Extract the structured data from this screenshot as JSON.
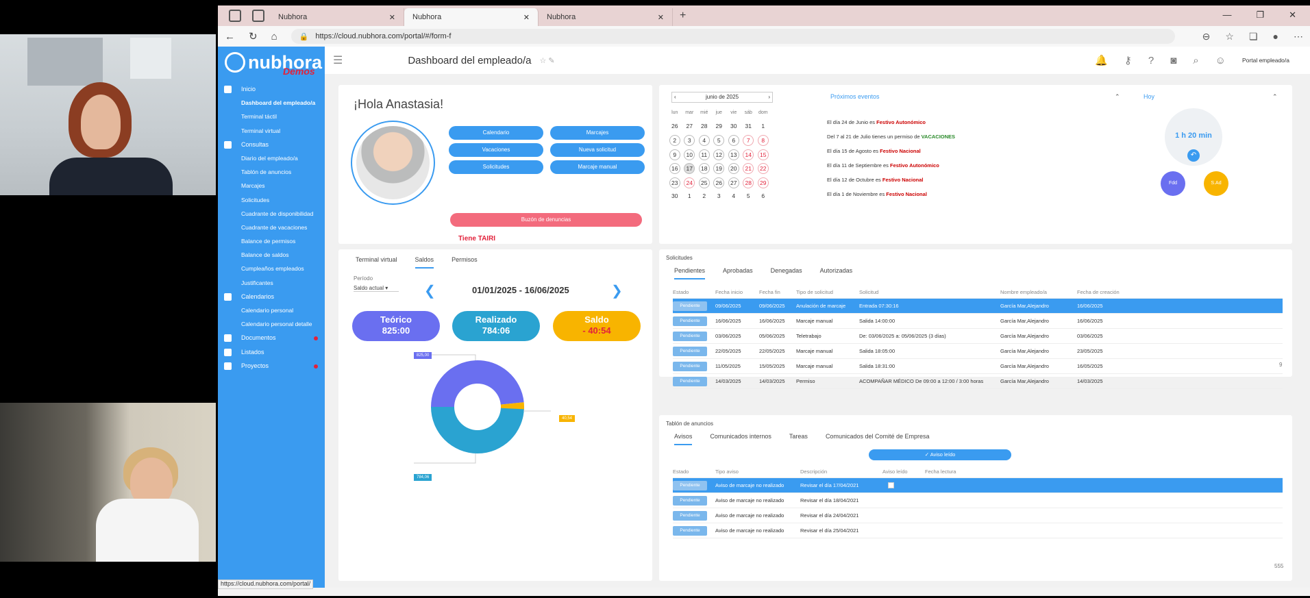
{
  "browser": {
    "tabs": [
      "Nubhora",
      "Nubhora",
      "Nubhora"
    ],
    "url": "https://cloud.nubhora.com/portal/#/form-f",
    "status_url": "https://cloud.nubhora.com/portal/"
  },
  "sidebar": {
    "logo": "nubhora",
    "demos": "Demos",
    "items": [
      {
        "label": "Inicio",
        "type": "sec"
      },
      {
        "label": "Dashboard del empleado/a",
        "type": "sub",
        "bold": true
      },
      {
        "label": "Terminal táctil",
        "type": "sub"
      },
      {
        "label": "Terminal virtual",
        "type": "sub"
      },
      {
        "label": "Consultas",
        "type": "sec"
      },
      {
        "label": "Diario del empleado/a",
        "type": "sub"
      },
      {
        "label": "Tablón de anuncios",
        "type": "sub"
      },
      {
        "label": "Marcajes",
        "type": "sub"
      },
      {
        "label": "Solicitudes",
        "type": "sub"
      },
      {
        "label": "Cuadrante de disponibilidad",
        "type": "sub"
      },
      {
        "label": "Cuadrante de vacaciones",
        "type": "sub"
      },
      {
        "label": "Balance de permisos",
        "type": "sub"
      },
      {
        "label": "Balance de saldos",
        "type": "sub"
      },
      {
        "label": "Cumpleaños empleados",
        "type": "sub"
      },
      {
        "label": "Justificantes",
        "type": "sub"
      },
      {
        "label": "Calendarios",
        "type": "sec"
      },
      {
        "label": "Calendario personal",
        "type": "sub"
      },
      {
        "label": "Calendario personal detalle",
        "type": "sub"
      },
      {
        "label": "Documentos",
        "type": "sec",
        "dot": true
      },
      {
        "label": "Listados",
        "type": "sec"
      },
      {
        "label": "Proyectos",
        "type": "sec",
        "dot": true
      }
    ]
  },
  "header": {
    "title": "Dashboard del empleado/a",
    "portal": "Portal empleado/a"
  },
  "welcome": {
    "greeting": "¡Hola Anastasia!",
    "buttons": [
      "Calendario",
      "Marcajes",
      "Vacaciones",
      "Nueva solicitud",
      "Solicitudes",
      "Marcaje manual"
    ],
    "pink_button": "Buzón de denuncias",
    "tiene": "Tiene TAIRI"
  },
  "calendar": {
    "month": "junio de 2025",
    "days": [
      "lun",
      "mar",
      "mié",
      "jue",
      "vie",
      "sáb",
      "dom"
    ],
    "weeks": [
      [
        "26",
        "27",
        "28",
        "29",
        "30",
        "31",
        "1"
      ],
      [
        "2",
        "3",
        "4",
        "5",
        "6",
        "7",
        "8"
      ],
      [
        "9",
        "10",
        "11",
        "12",
        "13",
        "14",
        "15"
      ],
      [
        "16",
        "17",
        "18",
        "19",
        "20",
        "21",
        "22"
      ],
      [
        "23",
        "24",
        "25",
        "26",
        "27",
        "28",
        "29"
      ],
      [
        "30",
        "1",
        "2",
        "3",
        "4",
        "5",
        "6"
      ]
    ]
  },
  "events": {
    "title": "Próximos eventos",
    "items": [
      {
        "text": "El día 24 de Junio es ",
        "tag": "Festivo Autonómico",
        "green": false
      },
      {
        "text": "Del 7 al 21 de Julio tienes un permiso de ",
        "tag": "VACACIONES",
        "green": true
      },
      {
        "text": "El día 15 de Agosto es ",
        "tag": "Festivo Nacional",
        "green": false
      },
      {
        "text": "El día 11 de Septiembre es ",
        "tag": "Festivo Autonómico",
        "green": false
      },
      {
        "text": "El día 12 de Octubre es ",
        "tag": "Festivo Nacional",
        "green": false
      },
      {
        "text": "El día 1 de Noviembre es ",
        "tag": "Festivo Nacional",
        "green": false
      }
    ]
  },
  "today": {
    "title": "Hoy",
    "time": "1 h 20 min",
    "fdd": "Fdd",
    "sal": "S.Ad"
  },
  "balance": {
    "tabs": [
      "Terminal virtual",
      "Saldos",
      "Permisos"
    ],
    "periodo_label": "Período",
    "periodo_value": "Saldo actual",
    "range": "01/01/2025 - 16/06/2025",
    "teorico_label": "Teórico",
    "teorico_value": "825:00",
    "realizado_label": "Realizado",
    "realizado_value": "784:06",
    "saldo_label": "Saldo",
    "saldo_value": "- 40:54",
    "label_top": "825,00",
    "label_right": "40,54",
    "label_bottom": "784,06",
    "colors": {
      "teorico": "#6a6ff0",
      "realizado": "#2aa3d1",
      "saldo": "#f8b400"
    }
  },
  "chart_data": {
    "type": "pie",
    "categories": [
      "Teórico",
      "Realizado",
      "Saldo"
    ],
    "values": [
      825.0,
      784.06,
      40.54
    ]
  },
  "solicitudes": {
    "title": "Solicitudes",
    "tabs": [
      "Pendientes",
      "Aprobadas",
      "Denegadas",
      "Autorizadas"
    ],
    "columns": [
      "Estado",
      "Fecha inicio",
      "Fecha fin",
      "Tipo de solicitud",
      "Solicitud",
      "Nombre empleado/a",
      "Fecha de creación"
    ],
    "rows": [
      [
        "Pendiente",
        "09/06/2025",
        "09/06/2025",
        "Anulación de marcaje",
        "Entrada 07:30:16",
        "García Mar,Alejandro",
        "16/06/2025"
      ],
      [
        "Pendiente",
        "16/06/2025",
        "16/06/2025",
        "Marcaje manual",
        "Salida 14:00:00",
        "García Mar,Alejandro",
        "16/06/2025"
      ],
      [
        "Pendiente",
        "03/06/2025",
        "05/06/2025",
        "Teletrabajo",
        "De: 03/06/2025 a: 05/06/2025 (3 días)",
        "García Mar,Alejandro",
        "03/06/2025"
      ],
      [
        "Pendiente",
        "22/05/2025",
        "22/05/2025",
        "Marcaje manual",
        "Salida 18:05:00",
        "García Mar,Alejandro",
        "23/05/2025"
      ],
      [
        "Pendiente",
        "11/05/2025",
        "15/05/2025",
        "Marcaje manual",
        "Salida 18:31:00",
        "García Mar,Alejandro",
        "16/05/2025"
      ],
      [
        "Pendiente",
        "14/03/2025",
        "14/03/2025",
        "Permiso",
        "ACOMPAÑAR MÉDICO De 09:00 a 12:00 / 3:00 horas",
        "García Mar,Alejandro",
        "14/03/2025"
      ]
    ],
    "count": "9"
  },
  "anuncios": {
    "title": "Tablón de anuncios",
    "tabs": [
      "Avisos",
      "Comunicados internos",
      "Tareas",
      "Comunicados del Comité de Empresa"
    ],
    "button": "Aviso leído",
    "columns": [
      "Estado",
      "Tipo aviso",
      "Descripción",
      "Aviso leído",
      "Fecha lectura"
    ],
    "rows": [
      [
        "Pendiente",
        "Aviso de marcaje no realizado",
        "Revisar el día 17/04/2021"
      ],
      [
        "Pendiente",
        "Aviso de marcaje no realizado",
        "Revisar el día 18/04/2021"
      ],
      [
        "Pendiente",
        "Aviso de marcaje no realizado",
        "Revisar el día 24/04/2021"
      ],
      [
        "Pendiente",
        "Aviso de marcaje no realizado",
        "Revisar el día 25/04/2021"
      ]
    ],
    "count": "555"
  }
}
